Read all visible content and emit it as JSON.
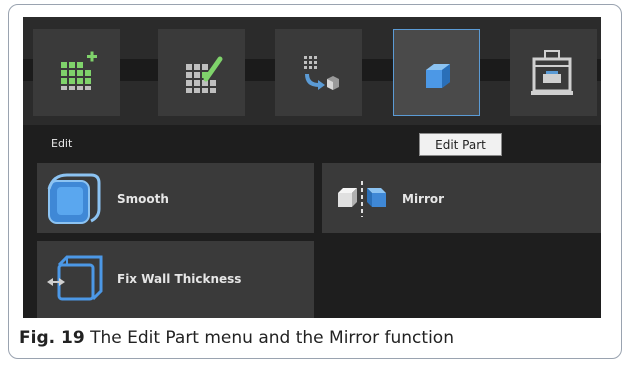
{
  "toolbar": {
    "buttons": [
      {
        "name": "add-part-grid",
        "icon": "grid-plus-icon"
      },
      {
        "name": "edit-grid",
        "icon": "grid-pencil-icon"
      },
      {
        "name": "move-parts",
        "icon": "grid-arrow-cube-icon"
      },
      {
        "name": "edit-part",
        "icon": "cube-icon",
        "active": true
      },
      {
        "name": "printer",
        "icon": "3d-printer-icon"
      }
    ],
    "tooltip": "Edit Part"
  },
  "edit_panel": {
    "section_label": "Edit",
    "commands": [
      {
        "label": "Smooth",
        "icon": "smooth-cube-icon"
      },
      {
        "label": "Mirror",
        "icon": "mirror-cubes-icon"
      },
      {
        "label": "Fix Wall Thickness",
        "icon": "wall-thickness-icon"
      }
    ]
  },
  "caption": {
    "fig_label": "Fig. 19",
    "text": "The Edit Part menu and the Mirror function"
  },
  "colors": {
    "accent_blue": "#5b9bd5",
    "grid_green": "#7fd36b",
    "panel_bg": "#3a3a3a",
    "app_bg": "#1e1e1e"
  }
}
